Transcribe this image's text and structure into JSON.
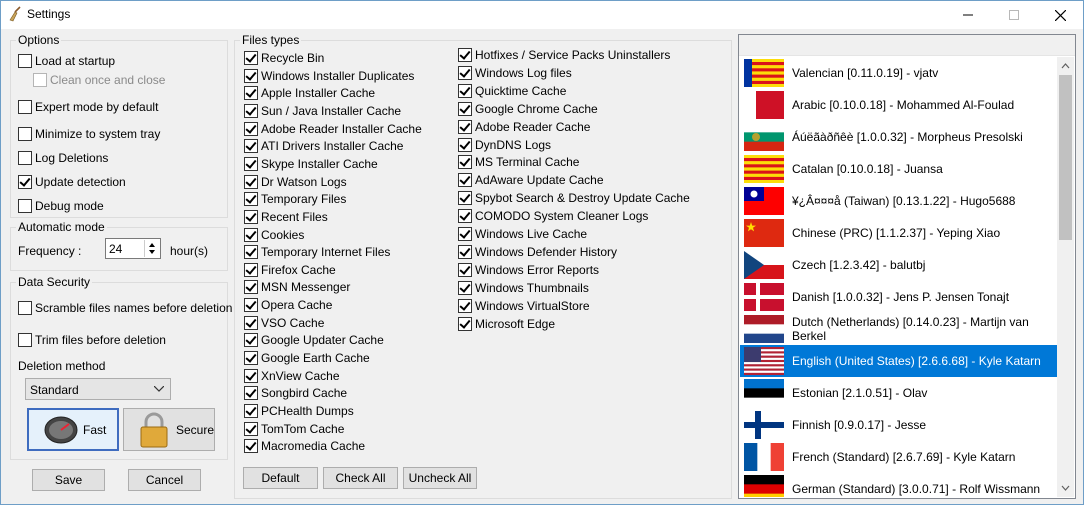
{
  "window": {
    "title": "Settings"
  },
  "options": {
    "legend": "Options",
    "load_at_startup": "Load at startup",
    "clean_once_close": "Clean once and close",
    "expert_mode": "Expert mode by default",
    "minimize_tray": "Minimize to system tray",
    "log_deletions": "Log Deletions",
    "update_detection": "Update detection",
    "debug_mode": "Debug mode"
  },
  "automatic_mode": {
    "legend": "Automatic mode",
    "frequency_label": "Frequency :",
    "frequency_value": "24",
    "unit": "hour(s)"
  },
  "data_security": {
    "legend": "Data Security",
    "scramble": "Scramble files names before deletion",
    "trim": "Trim files before deletion",
    "deletion_method_label": "Deletion method",
    "deletion_method_value": "Standard",
    "fast_label": "Fast",
    "secure_label": "Secure"
  },
  "buttons": {
    "save": "Save",
    "cancel": "Cancel",
    "default": "Default",
    "check_all": "Check All",
    "uncheck_all": "Uncheck All"
  },
  "files_types": {
    "legend": "Files types",
    "col1": [
      "Recycle Bin",
      "Windows Installer Duplicates",
      "Apple Installer Cache",
      "Sun / Java Installer Cache",
      "Adobe Reader Installer Cache",
      "ATI Drivers Installer Cache",
      "Skype Installer Cache",
      "Dr Watson Logs",
      "Temporary Files",
      "Recent Files",
      "Cookies",
      "Temporary Internet Files",
      "Firefox Cache",
      "MSN Messenger",
      "Opera Cache",
      "VSO Cache",
      "Google Updater Cache",
      "Google Earth Cache",
      "XnView Cache",
      "Songbird Cache",
      "PCHealth Dumps",
      "TomTom Cache",
      "Macromedia Cache"
    ],
    "col2": [
      "Hotfixes / Service Packs Uninstallers",
      "Windows Log files",
      "Quicktime Cache",
      "Google Chrome Cache",
      "Adobe Reader Cache",
      "DynDNS Logs",
      "MS Terminal Cache",
      "AdAware Update Cache",
      "Spybot Search & Destroy Update Cache",
      "COMODO System Cleaner Logs",
      "Windows Live Cache",
      "Windows Defender History",
      "Windows Error Reports",
      "Windows Thumbnails",
      "Windows VirtualStore",
      "Microsoft Edge"
    ]
  },
  "languages": [
    {
      "label": "Valencian [0.11.0.19] - vjatv",
      "flag": "valencia"
    },
    {
      "label": "Arabic [0.10.0.18] - Mohammed Al-Foulad",
      "flag": "arabic"
    },
    {
      "label": "Áúëãàðñêè [1.0.0.32] - Morpheus Presolski",
      "flag": "bulgaria"
    },
    {
      "label": "Catalan [0.10.0.18] - Juansa",
      "flag": "catalonia"
    },
    {
      "label": "¥¿Â¤¤¤å (Taiwan) [0.13.1.22] - Hugo5688",
      "flag": "taiwan"
    },
    {
      "label": "Chinese (PRC) [1.1.2.37] - Yeping Xiao",
      "flag": "china"
    },
    {
      "label": "Czech [1.2.3.42] - balutbj",
      "flag": "czech"
    },
    {
      "label": "Danish [1.0.0.32] - Jens P. Jensen Tonajt",
      "flag": "denmark"
    },
    {
      "label": "Dutch (Netherlands) [0.14.0.23] - Martijn van Berkel",
      "flag": "netherlands"
    },
    {
      "label": "English (United States) [2.6.6.68] - Kyle Katarn",
      "flag": "usa",
      "selected": true
    },
    {
      "label": "Estonian [2.1.0.51] - Olav",
      "flag": "estonia"
    },
    {
      "label": "Finnish [0.9.0.17] - Jesse",
      "flag": "finland"
    },
    {
      "label": "French (Standard) [2.6.7.69] - Kyle Katarn",
      "flag": "france"
    },
    {
      "label": "German (Standard) [3.0.0.71] - Rolf Wissmann",
      "flag": "germany"
    }
  ]
}
